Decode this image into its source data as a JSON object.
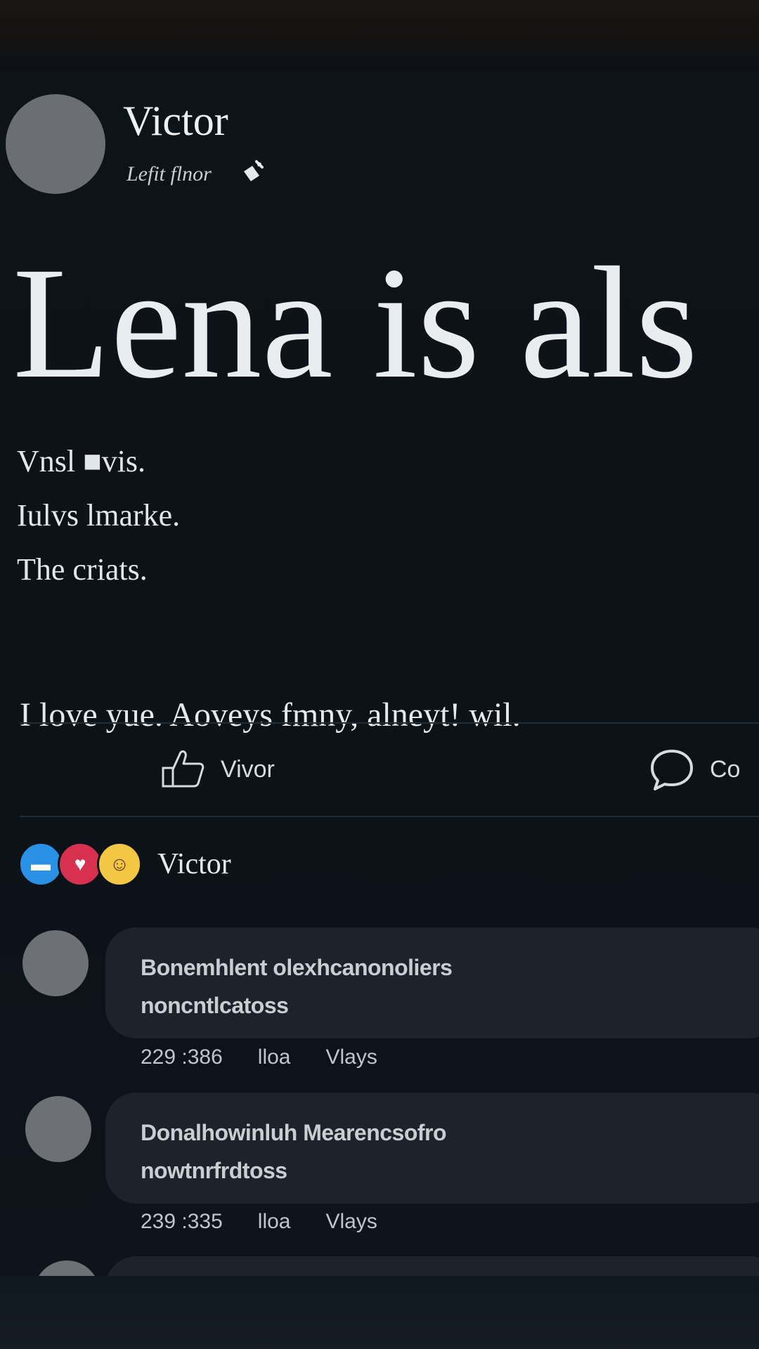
{
  "post": {
    "author": "Victor",
    "meta": "Lefit flnor",
    "headline": "Lena is als",
    "body_lines": [
      "Vnsl ■vis.",
      "Iulvs lmarke.",
      "The criats."
    ],
    "love_line": "I love yue. Aoveys fmny, alneyt! wil."
  },
  "actions": {
    "like_label": "Vivor",
    "comment_label": "Co"
  },
  "reactions": {
    "icons": [
      "chat-bubble-icon",
      "heart-icon",
      "sunglasses-emoji-icon"
    ],
    "name": "Victor"
  },
  "comments": [
    {
      "line1": "Bonemhlent olexhcanonoliers",
      "line2": "noncntlcatoss",
      "time": "229 :386",
      "like": "lloa",
      "reply": "Vlays"
    },
    {
      "line1": "Donalhowinluh Mearencsofro",
      "line2": "nowtnrfrdtoss",
      "time": "239 :335",
      "like": "lloa",
      "reply": "Vlays"
    }
  ],
  "colors": {
    "background": "#0b1219",
    "bubble": "#1c232a",
    "text": "#e6e9ec"
  }
}
